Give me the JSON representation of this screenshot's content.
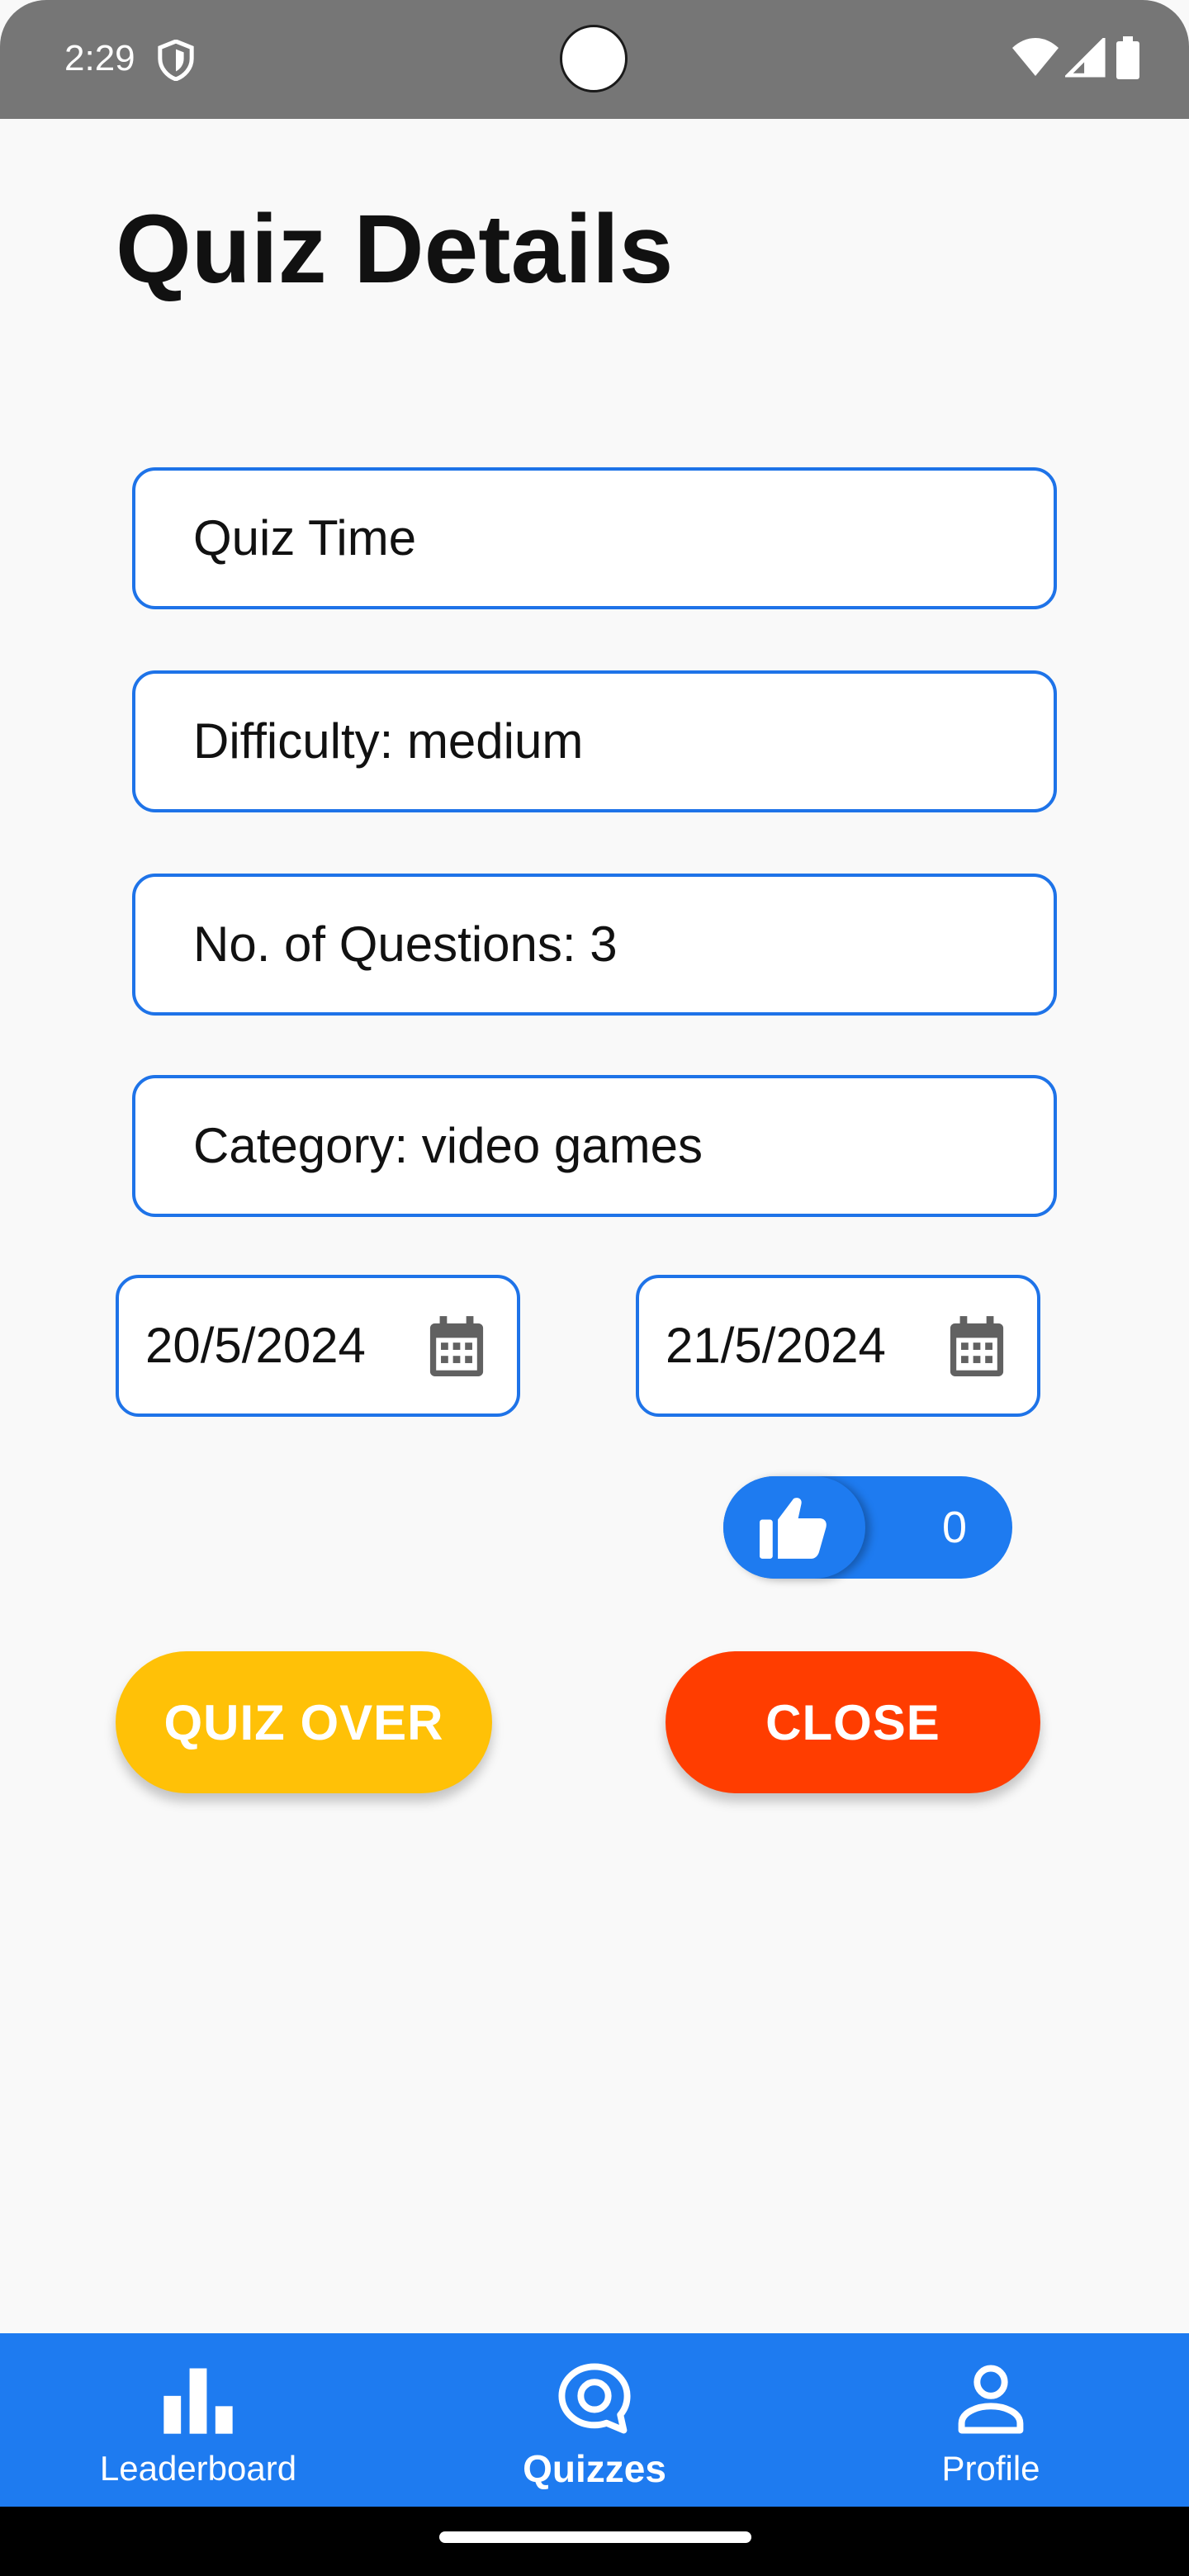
{
  "status_bar": {
    "time": "2:29",
    "icons": [
      "shield-icon",
      "wifi-icon",
      "signal-icon",
      "battery-icon"
    ]
  },
  "page": {
    "title": "Quiz Details"
  },
  "fields": {
    "quiz_name": "Quiz Time",
    "difficulty": "Difficulty: medium",
    "questions": "No. of Questions: 3",
    "category": "Category: video games"
  },
  "dates": {
    "start": "20/5/2024",
    "end": "21/5/2024"
  },
  "likes": {
    "count": "0"
  },
  "buttons": {
    "quiz_over": "QUIZ OVER",
    "close": "CLOSE"
  },
  "bottom_nav": {
    "items": [
      {
        "label": "Leaderboard",
        "icon": "bar-chart-icon",
        "active": false
      },
      {
        "label": "Quizzes",
        "icon": "chat-bubble-icon",
        "active": true
      },
      {
        "label": "Profile",
        "icon": "person-icon",
        "active": false
      }
    ]
  },
  "colors": {
    "primary": "#1e7bf0",
    "field_border": "#1e73e8",
    "quiz_over": "#ffc107",
    "close": "#ff3d00",
    "background": "#f9f9f9",
    "status_bar": "#767676"
  }
}
